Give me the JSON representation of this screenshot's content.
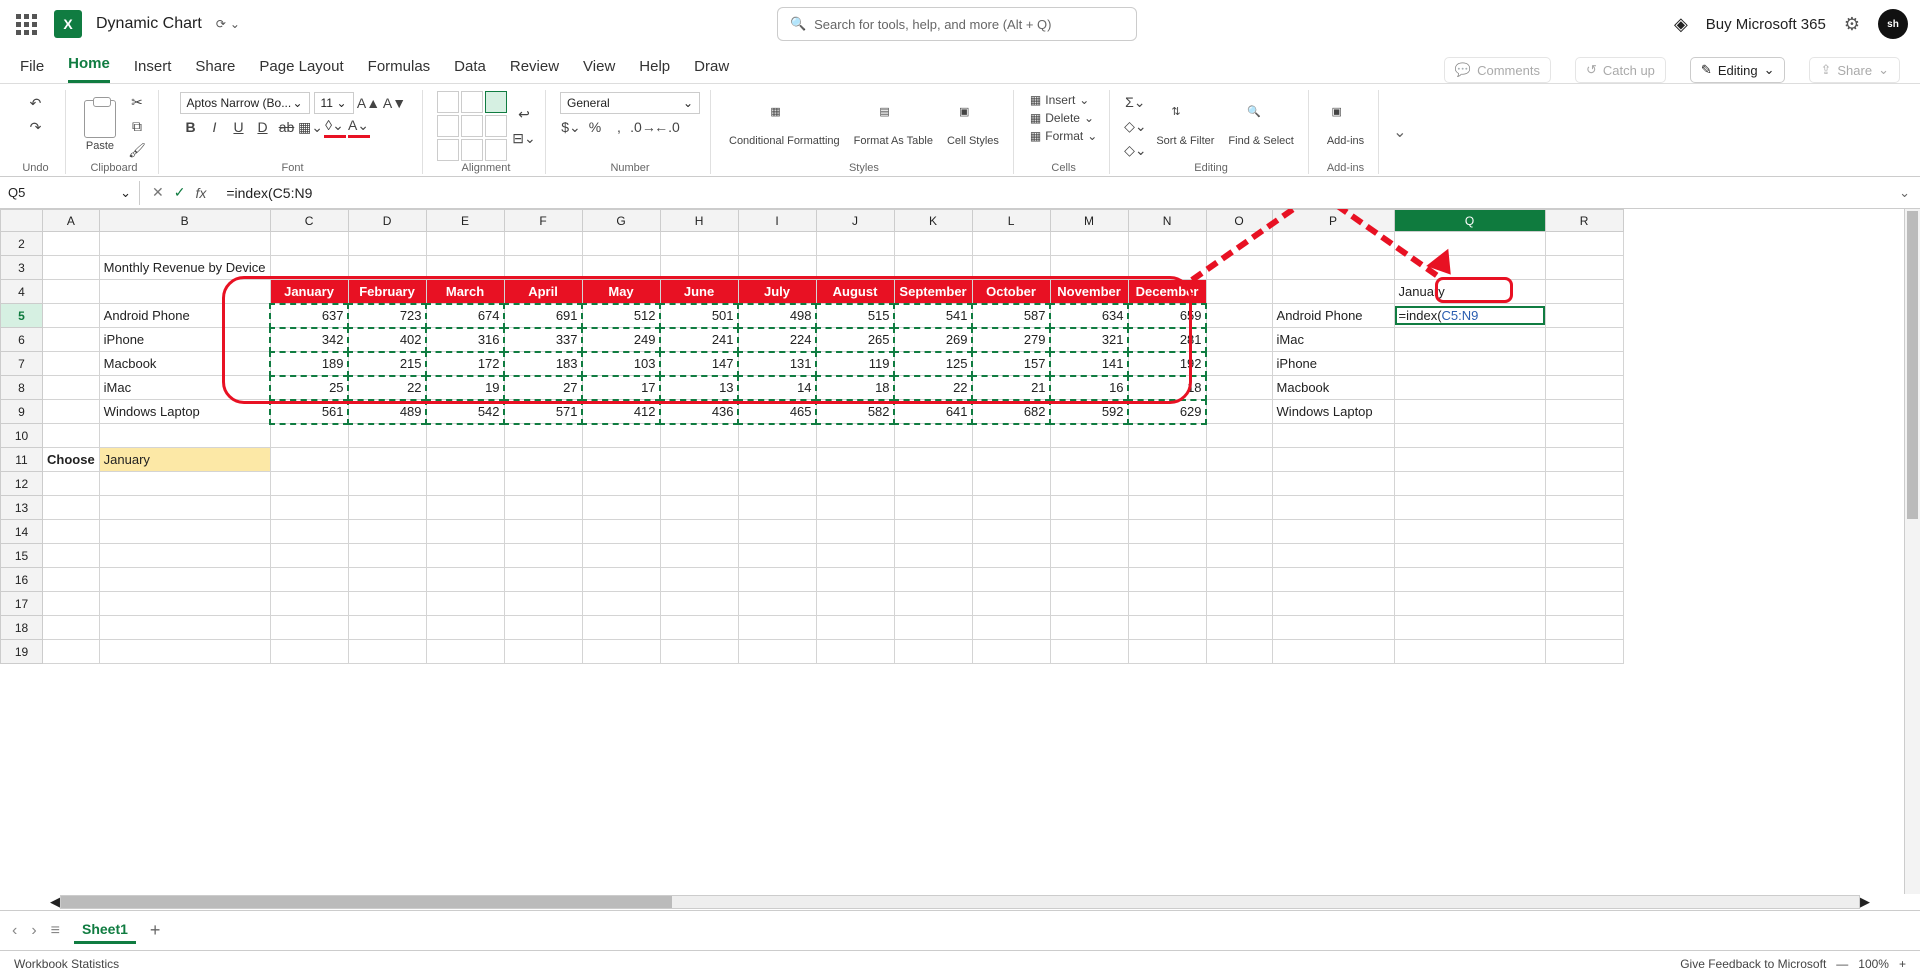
{
  "title": "Dynamic Chart",
  "search_placeholder": "Search for tools, help, and more (Alt + Q)",
  "buy": "Buy Microsoft 365",
  "tabs": [
    "File",
    "Home",
    "Insert",
    "Share",
    "Page Layout",
    "Formulas",
    "Data",
    "Review",
    "View",
    "Help",
    "Draw"
  ],
  "active_tab": "Home",
  "right_btns": {
    "comments": "Comments",
    "catchup": "Catch up",
    "editing": "Editing",
    "share": "Share"
  },
  "ribbon": {
    "undo": "Undo",
    "clipboard": "Clipboard",
    "paste": "Paste",
    "font": "Font",
    "font_name": "Aptos Narrow (Bo...",
    "font_size": "11",
    "alignment": "Alignment",
    "number": "Number",
    "number_fmt": "General",
    "styles": "Styles",
    "cond_fmt": "Conditional Formatting",
    "fmt_tbl": "Format As Table",
    "cell_styles": "Cell Styles",
    "cells": "Cells",
    "insert": "Insert",
    "delete": "Delete",
    "format": "Format",
    "editing": "Editing",
    "sort": "Sort & Filter",
    "find": "Find & Select",
    "addins": "Add-ins",
    "addins_btn": "Add-ins"
  },
  "name_box": "Q5",
  "formula": "=index(C5:N9",
  "cols": [
    "A",
    "B",
    "C",
    "D",
    "E",
    "F",
    "G",
    "H",
    "I",
    "J",
    "K",
    "L",
    "M",
    "N",
    "O",
    "P",
    "Q",
    "R"
  ],
  "rows_shown": [
    2,
    3,
    4,
    5,
    6,
    7,
    8,
    9,
    10,
    11,
    12,
    13,
    14,
    15,
    16,
    17,
    18,
    19
  ],
  "title_cell": "Monthly Revenue by Device",
  "months": [
    "January",
    "February",
    "March",
    "April",
    "May",
    "June",
    "July",
    "August",
    "September",
    "October",
    "November",
    "December"
  ],
  "devices": [
    "Android Phone",
    "iPhone",
    "Macbook",
    "iMac",
    "Windows Laptop"
  ],
  "data": [
    [
      637,
      723,
      674,
      691,
      512,
      501,
      498,
      515,
      541,
      587,
      634,
      659
    ],
    [
      342,
      402,
      316,
      337,
      249,
      241,
      224,
      265,
      269,
      279,
      321,
      281
    ],
    [
      189,
      215,
      172,
      183,
      103,
      147,
      131,
      119,
      125,
      157,
      141,
      192
    ],
    [
      25,
      22,
      19,
      27,
      17,
      13,
      14,
      18,
      22,
      21,
      16,
      18
    ],
    [
      561,
      489,
      542,
      571,
      412,
      436,
      465,
      582,
      641,
      682,
      592,
      629
    ]
  ],
  "choose_label": "Choose",
  "choose_value": "January",
  "side_list": [
    "Android Phone",
    "iMac",
    "iPhone",
    "Macbook",
    "Windows Laptop"
  ],
  "side_header": "January",
  "q5_static": "=index(",
  "q5_ref": "C5:N9",
  "sheet_name": "Sheet1",
  "status_left": "Workbook Statistics",
  "status_right": "Give Feedback to Microsoft",
  "zoom": "100%",
  "chart_data": {
    "type": "table",
    "title": "Monthly Revenue by Device",
    "categories": [
      "January",
      "February",
      "March",
      "April",
      "May",
      "June",
      "July",
      "August",
      "September",
      "October",
      "November",
      "December"
    ],
    "series": [
      {
        "name": "Android Phone",
        "values": [
          637,
          723,
          674,
          691,
          512,
          501,
          498,
          515,
          541,
          587,
          634,
          659
        ]
      },
      {
        "name": "iPhone",
        "values": [
          342,
          402,
          316,
          337,
          249,
          241,
          224,
          265,
          269,
          279,
          321,
          281
        ]
      },
      {
        "name": "Macbook",
        "values": [
          189,
          215,
          172,
          183,
          103,
          147,
          131,
          119,
          125,
          157,
          141,
          192
        ]
      },
      {
        "name": "iMac",
        "values": [
          25,
          22,
          19,
          27,
          17,
          13,
          14,
          18,
          22,
          21,
          16,
          18
        ]
      },
      {
        "name": "Windows Laptop",
        "values": [
          561,
          489,
          542,
          571,
          412,
          436,
          465,
          582,
          641,
          682,
          592,
          629
        ]
      }
    ]
  }
}
